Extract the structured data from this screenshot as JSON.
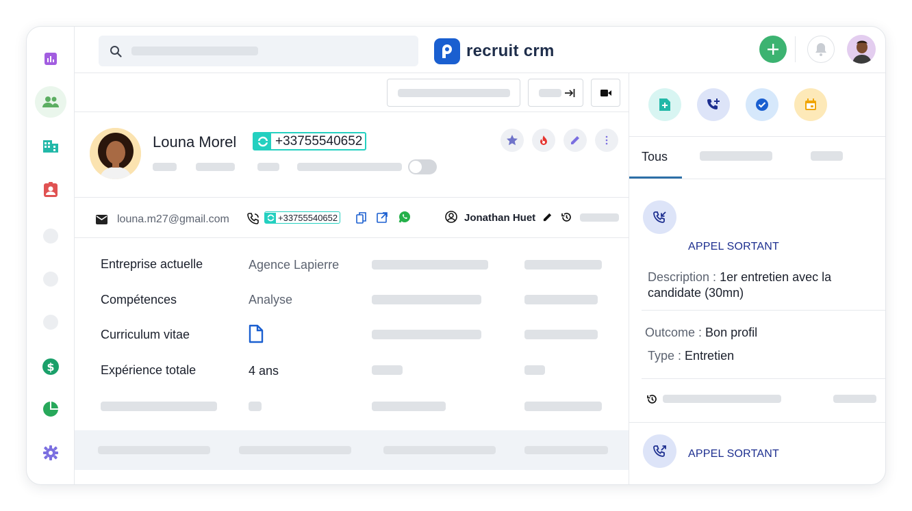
{
  "brand": {
    "name": "recruit crm",
    "accent": "#1a5fd0"
  },
  "sidebar": {
    "items": [
      {
        "icon": "bar-chart-icon",
        "color": "#a25de0"
      },
      {
        "icon": "people-icon",
        "color": "#5cae62",
        "active": true
      },
      {
        "icon": "building-icon",
        "color": "#22b8a8"
      },
      {
        "icon": "id-badge-icon",
        "color": "#e05252"
      },
      {
        "icon": "dollar-icon",
        "color": "#1aa06a"
      },
      {
        "icon": "pie-chart-icon",
        "color": "#27a85a"
      },
      {
        "icon": "gear-icon",
        "color": "#7b6fe0"
      }
    ]
  },
  "candidate": {
    "name": "Louna Morel",
    "phone": "+33755540652",
    "email": "louna.m27@gmail.com",
    "phone_small": "+33755540652",
    "owner": "Jonathan Huet"
  },
  "fields": [
    {
      "label": "Entreprise actuelle",
      "value": "Agence Lapierre"
    },
    {
      "label": "Compétences",
      "value": "Analyse"
    },
    {
      "label": "Curriculum vitae",
      "value": ""
    },
    {
      "label": "Expérience totale",
      "value": "4 ans"
    }
  ],
  "right_panel": {
    "tabs": [
      {
        "label": "Tous",
        "active": true
      }
    ],
    "activities": [
      {
        "title": "APPEL SORTANT",
        "description_label": "Description :",
        "description": "1er entretien avec la candidate (30mn)",
        "outcome_label": "Outcome :",
        "outcome": "Bon profil",
        "type_label": "Type :",
        "type": "Entretien"
      },
      {
        "title": "APPEL SORTANT"
      }
    ]
  }
}
